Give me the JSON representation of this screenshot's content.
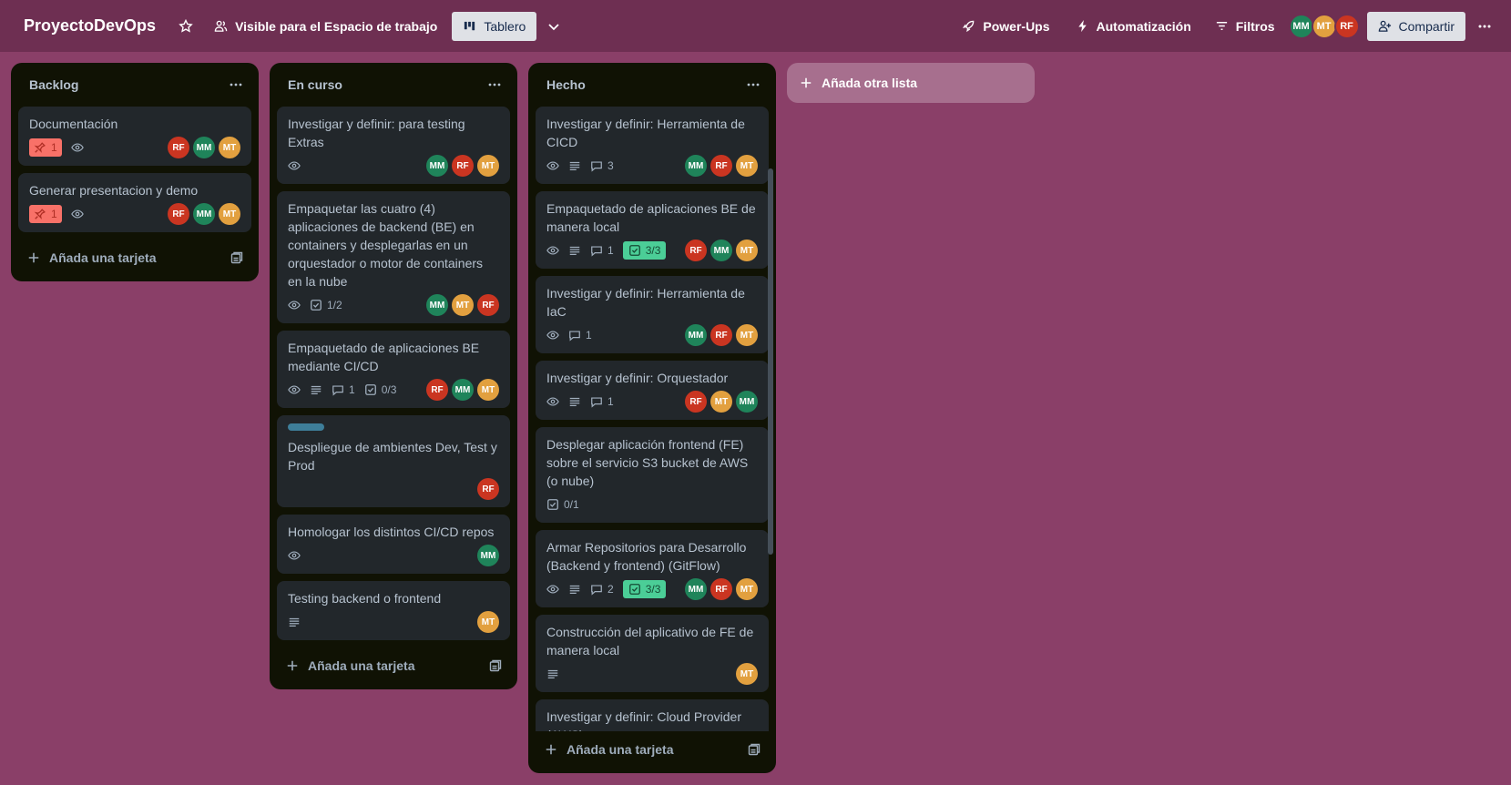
{
  "header": {
    "board_title": "ProyectoDevOps",
    "visibility_label": "Visible para el Espacio de trabajo",
    "view_label": "Tablero",
    "powerups_label": "Power-Ups",
    "automation_label": "Automatización",
    "filters_label": "Filtros",
    "share_label": "Compartir",
    "members": [
      "MM",
      "MT",
      "RF"
    ]
  },
  "colors": {
    "board_bg": "#8a3f68",
    "topbar_bg": "#6e2f52",
    "list_bg": "#101204",
    "card_bg": "#22272b",
    "avatar_rf": "#ca3521",
    "avatar_mm": "#1f845a",
    "avatar_mt": "#e2a03f",
    "badge_due_red": "#f87168",
    "badge_checklist_green": "#4bce97",
    "label_blue": "#3e7e99"
  },
  "add_card_label": "Añada una tarjeta",
  "add_list_label": "Añada otra lista",
  "lists": [
    {
      "title": "Backlog",
      "cards": [
        {
          "title": "Documentación",
          "notification": "1",
          "members": [
            "RF",
            "MM",
            "MT"
          ]
        },
        {
          "title": "Generar presentacion y demo",
          "notification": "1",
          "members": [
            "RF",
            "MM",
            "MT"
          ]
        }
      ]
    },
    {
      "title": "En curso",
      "cards": [
        {
          "title": "Investigar y definir: para testing Extras",
          "members": [
            "MM",
            "RF",
            "MT"
          ]
        },
        {
          "title": "Empaquetar las cuatro (4) aplicaciones de backend (BE) en containers y desplegarlas en un orquestador o motor de containers en la nube",
          "checklist": "1/2",
          "members": [
            "MM",
            "MT",
            "RF"
          ]
        },
        {
          "title": "Empaquetado de aplicaciones BE mediante CI/CD",
          "comments": "1",
          "checklist": "0/3",
          "members": [
            "RF",
            "MM",
            "MT"
          ]
        },
        {
          "title": "Despliegue de ambientes Dev, Test y Prod",
          "members": [
            "RF"
          ]
        },
        {
          "title": "Homologar los distintos CI/CD repos",
          "members": [
            "MM"
          ]
        },
        {
          "title": "Testing backend o frontend",
          "members": [
            "MT"
          ]
        }
      ]
    },
    {
      "title": "Hecho",
      "cards": [
        {
          "title": "Investigar y definir: Herramienta de CICD",
          "comments": "3",
          "members": [
            "MM",
            "RF",
            "MT"
          ]
        },
        {
          "title": "Empaquetado de aplicaciones BE de manera local",
          "comments": "1",
          "checklist": "3/3",
          "members": [
            "RF",
            "MM",
            "MT"
          ]
        },
        {
          "title": "Investigar y definir: Herramienta de IaC",
          "comments": "1",
          "members": [
            "MM",
            "RF",
            "MT"
          ]
        },
        {
          "title": "Investigar y definir: Orquestador",
          "comments": "1",
          "members": [
            "RF",
            "MT",
            "MM"
          ]
        },
        {
          "title": "Desplegar aplicación frontend (FE) sobre el servicio S3 bucket de AWS (o nube)",
          "checklist": "0/1"
        },
        {
          "title": "Armar Repositorios para Desarrollo (Backend y frontend) (GitFlow)",
          "comments": "2",
          "checklist": "3/3",
          "members": [
            "MM",
            "RF",
            "MT"
          ]
        },
        {
          "title": "Construcción del aplicativo de FE de manera local",
          "members": [
            "MT"
          ]
        },
        {
          "title": "Investigar y definir: Cloud Provider (AWS)"
        }
      ]
    }
  ]
}
